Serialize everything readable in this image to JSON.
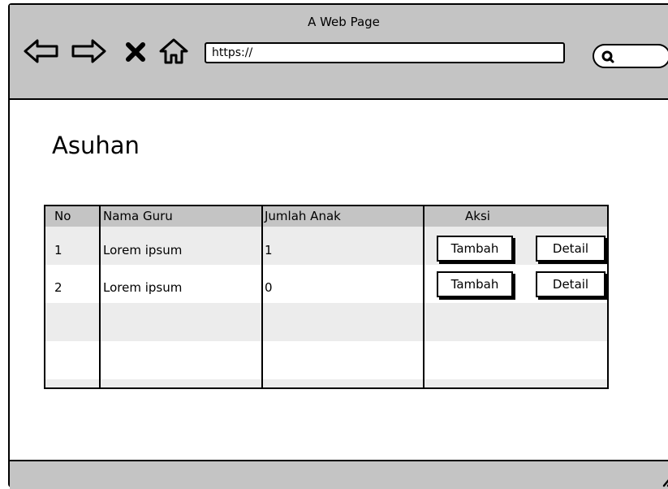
{
  "browser": {
    "window_title": "A Web Page",
    "url": "https://"
  },
  "page": {
    "heading": "Asuhan"
  },
  "table": {
    "columns": [
      "No",
      "Nama Guru",
      "Jumlah Anak",
      "Aksi"
    ],
    "rows": [
      {
        "no": "1",
        "nama_guru": "Lorem ipsum",
        "jumlah_anak": "1",
        "actions": [
          "Tambah",
          "Detail"
        ]
      },
      {
        "no": "2",
        "nama_guru": "Lorem ipsum",
        "jumlah_anak": "0",
        "actions": [
          "Tambah",
          "Detail"
        ]
      }
    ]
  },
  "icons": [
    "back-arrow-icon",
    "forward-arrow-icon",
    "close-icon",
    "home-icon",
    "search-icon",
    "resize-grip-icon"
  ],
  "colors": {
    "chrome": "#c4c4c4",
    "row_alt": "#ececec"
  }
}
